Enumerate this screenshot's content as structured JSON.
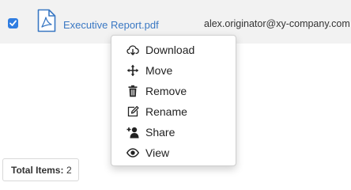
{
  "file_row": {
    "checked": true,
    "file_icon": "pdf-file-icon",
    "file_name": "Executive Report.pdf",
    "owner": "alex.originator@xy-company.com"
  },
  "context_menu": {
    "items": [
      {
        "label": "Download",
        "icon": "cloud-download-icon"
      },
      {
        "label": "Move",
        "icon": "move-arrows-icon"
      },
      {
        "label": "Remove",
        "icon": "trash-icon"
      },
      {
        "label": "Rename",
        "icon": "edit-icon"
      },
      {
        "label": "Share",
        "icon": "add-user-icon"
      },
      {
        "label": "View",
        "icon": "eye-icon"
      }
    ]
  },
  "footer": {
    "total_label": "Total Items:",
    "total_count": "2"
  },
  "colors": {
    "accent": "#2f7de1",
    "link": "#3a78c3",
    "row_bg": "#f2f2f2"
  }
}
